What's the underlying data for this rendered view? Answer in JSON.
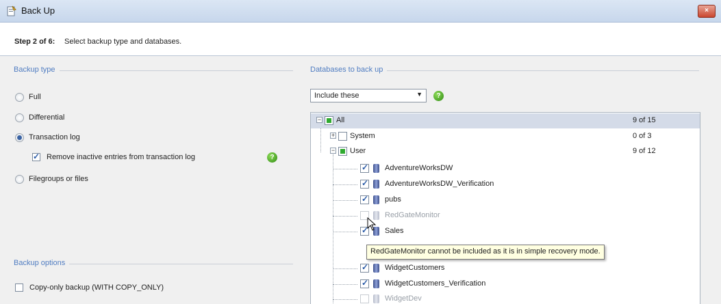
{
  "window": {
    "title": "Back Up",
    "close_icon": "×",
    "title_icon": "backup-wizard-icon"
  },
  "step": {
    "label": "Step 2 of 6:",
    "text": "Select backup type and databases."
  },
  "backup_type": {
    "title": "Backup type",
    "options": [
      {
        "label": "Full",
        "selected": false
      },
      {
        "label": "Differential",
        "selected": false
      },
      {
        "label": "Transaction log",
        "selected": true
      },
      {
        "label": "Filegroups or files",
        "selected": false
      }
    ],
    "remove_inactive": {
      "label": "Remove inactive entries from transaction log",
      "checked": true
    }
  },
  "backup_options": {
    "title": "Backup options",
    "copy_only": {
      "label": "Copy-only backup (WITH COPY_ONLY)",
      "checked": false
    }
  },
  "databases": {
    "title": "Databases to back up",
    "filter": "Include these",
    "tree": {
      "all": {
        "label": "All",
        "count": "9 of 15"
      },
      "system": {
        "label": "System",
        "count": "0 of 3"
      },
      "user": {
        "label": "User",
        "count": "9 of 12"
      },
      "items": [
        {
          "label": "AdventureWorksDW",
          "checked": true,
          "disabled": false
        },
        {
          "label": "AdventureWorksDW_Verification",
          "checked": true,
          "disabled": false
        },
        {
          "label": "pubs",
          "checked": true,
          "disabled": false
        },
        {
          "label": "RedGateMonitor",
          "checked": false,
          "disabled": true
        },
        {
          "label": "Sales",
          "checked": true,
          "disabled": false
        },
        {
          "label": "WidgetCustomers",
          "checked": true,
          "disabled": false
        },
        {
          "label": "WidgetCustomers_Verification",
          "checked": true,
          "disabled": false
        },
        {
          "label": "WidgetDev",
          "checked": false,
          "disabled": true
        }
      ]
    },
    "tooltip": "RedGateMonitor cannot be included as it is in simple recovery mode."
  },
  "colors": {
    "group_title": "#4f7cc1",
    "help_green": "#2e8a12",
    "selection": "#d4dbe8"
  }
}
